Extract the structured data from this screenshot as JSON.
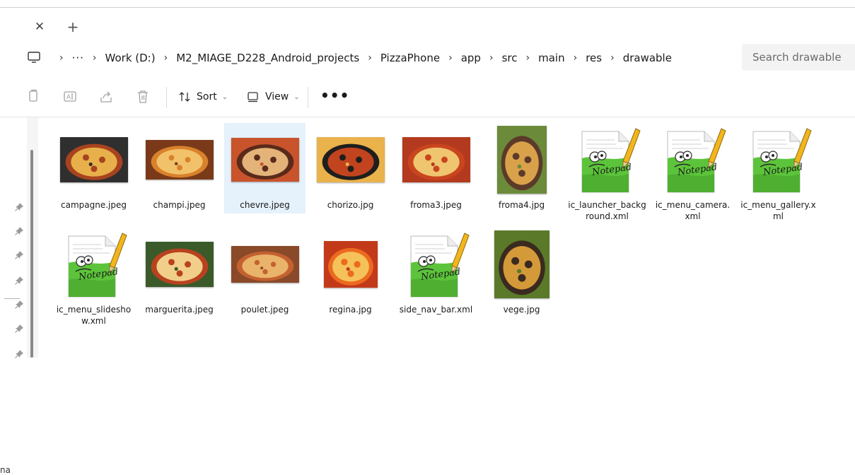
{
  "window": {
    "tab_close_glyph": "✕",
    "new_tab_glyph": "+"
  },
  "address": {
    "overflow": "···",
    "breadcrumbs": [
      "Work (D:)",
      "M2_MIAGE_D228_Android_projects",
      "PizzaPhone",
      "app",
      "src",
      "main",
      "res",
      "drawable"
    ],
    "separator": "›",
    "search_placeholder": "Search drawable"
  },
  "toolbar": {
    "icons": [
      "copy-icon",
      "rename-icon",
      "share-icon",
      "delete-icon"
    ],
    "sort_label": "Sort",
    "view_label": "View",
    "more_label": "•••",
    "chevron": "⌄"
  },
  "files": [
    {
      "name": "campagne.jpeg",
      "kind": "photo",
      "colors": [
        "#a8431f",
        "#e8b04a",
        "#2f2f2f"
      ]
    },
    {
      "name": "champi.jpeg",
      "kind": "photo",
      "colors": [
        "#d9822b",
        "#f2c26b",
        "#7a3a1a"
      ]
    },
    {
      "name": "chevre.jpeg",
      "kind": "photo",
      "colors": [
        "#5a2a1a",
        "#e3b37a",
        "#c9542c"
      ]
    },
    {
      "name": "chorizo.jpg",
      "kind": "photo",
      "colors": [
        "#1e1e1e",
        "#c1441f",
        "#e9b24a"
      ]
    },
    {
      "name": "froma3.jpeg",
      "kind": "photo",
      "colors": [
        "#c9451f",
        "#f0c56f",
        "#b43a1f"
      ]
    },
    {
      "name": "froma4.jpg",
      "kind": "photo",
      "colors": [
        "#5b3a2a",
        "#d9a14a",
        "#6b8a3a"
      ]
    },
    {
      "name": "ic_launcher_background.xml",
      "kind": "notepad"
    },
    {
      "name": "ic_menu_camera.xml",
      "kind": "notepad"
    },
    {
      "name": "ic_menu_gallery.xml",
      "kind": "notepad"
    },
    {
      "name": "ic_menu_slideshow.xml",
      "kind": "notepad"
    },
    {
      "name": "marguerita.jpeg",
      "kind": "photo",
      "colors": [
        "#b8421f",
        "#f1cf8a",
        "#3a5a2a"
      ]
    },
    {
      "name": "poulet.jpeg",
      "kind": "photo",
      "colors": [
        "#c4612f",
        "#e9b36a",
        "#8a4a2a"
      ]
    },
    {
      "name": "regina.jpg",
      "kind": "photo",
      "colors": [
        "#ec6a1f",
        "#f5c25a",
        "#c33a1a"
      ]
    },
    {
      "name": "side_nav_bar.xml",
      "kind": "notepad"
    },
    {
      "name": "vege.jpg",
      "kind": "photo",
      "colors": [
        "#3a2a1f",
        "#d49a3a",
        "#5a7a2a"
      ]
    }
  ],
  "selected_file": "chevre.jpeg",
  "navpane": {
    "pin_count": 7,
    "truncated_label": "na"
  },
  "colors": {
    "selection": "#e5f1fb",
    "notepad_green": "#5cc43a",
    "pencil_yellow": "#f2b51c"
  }
}
